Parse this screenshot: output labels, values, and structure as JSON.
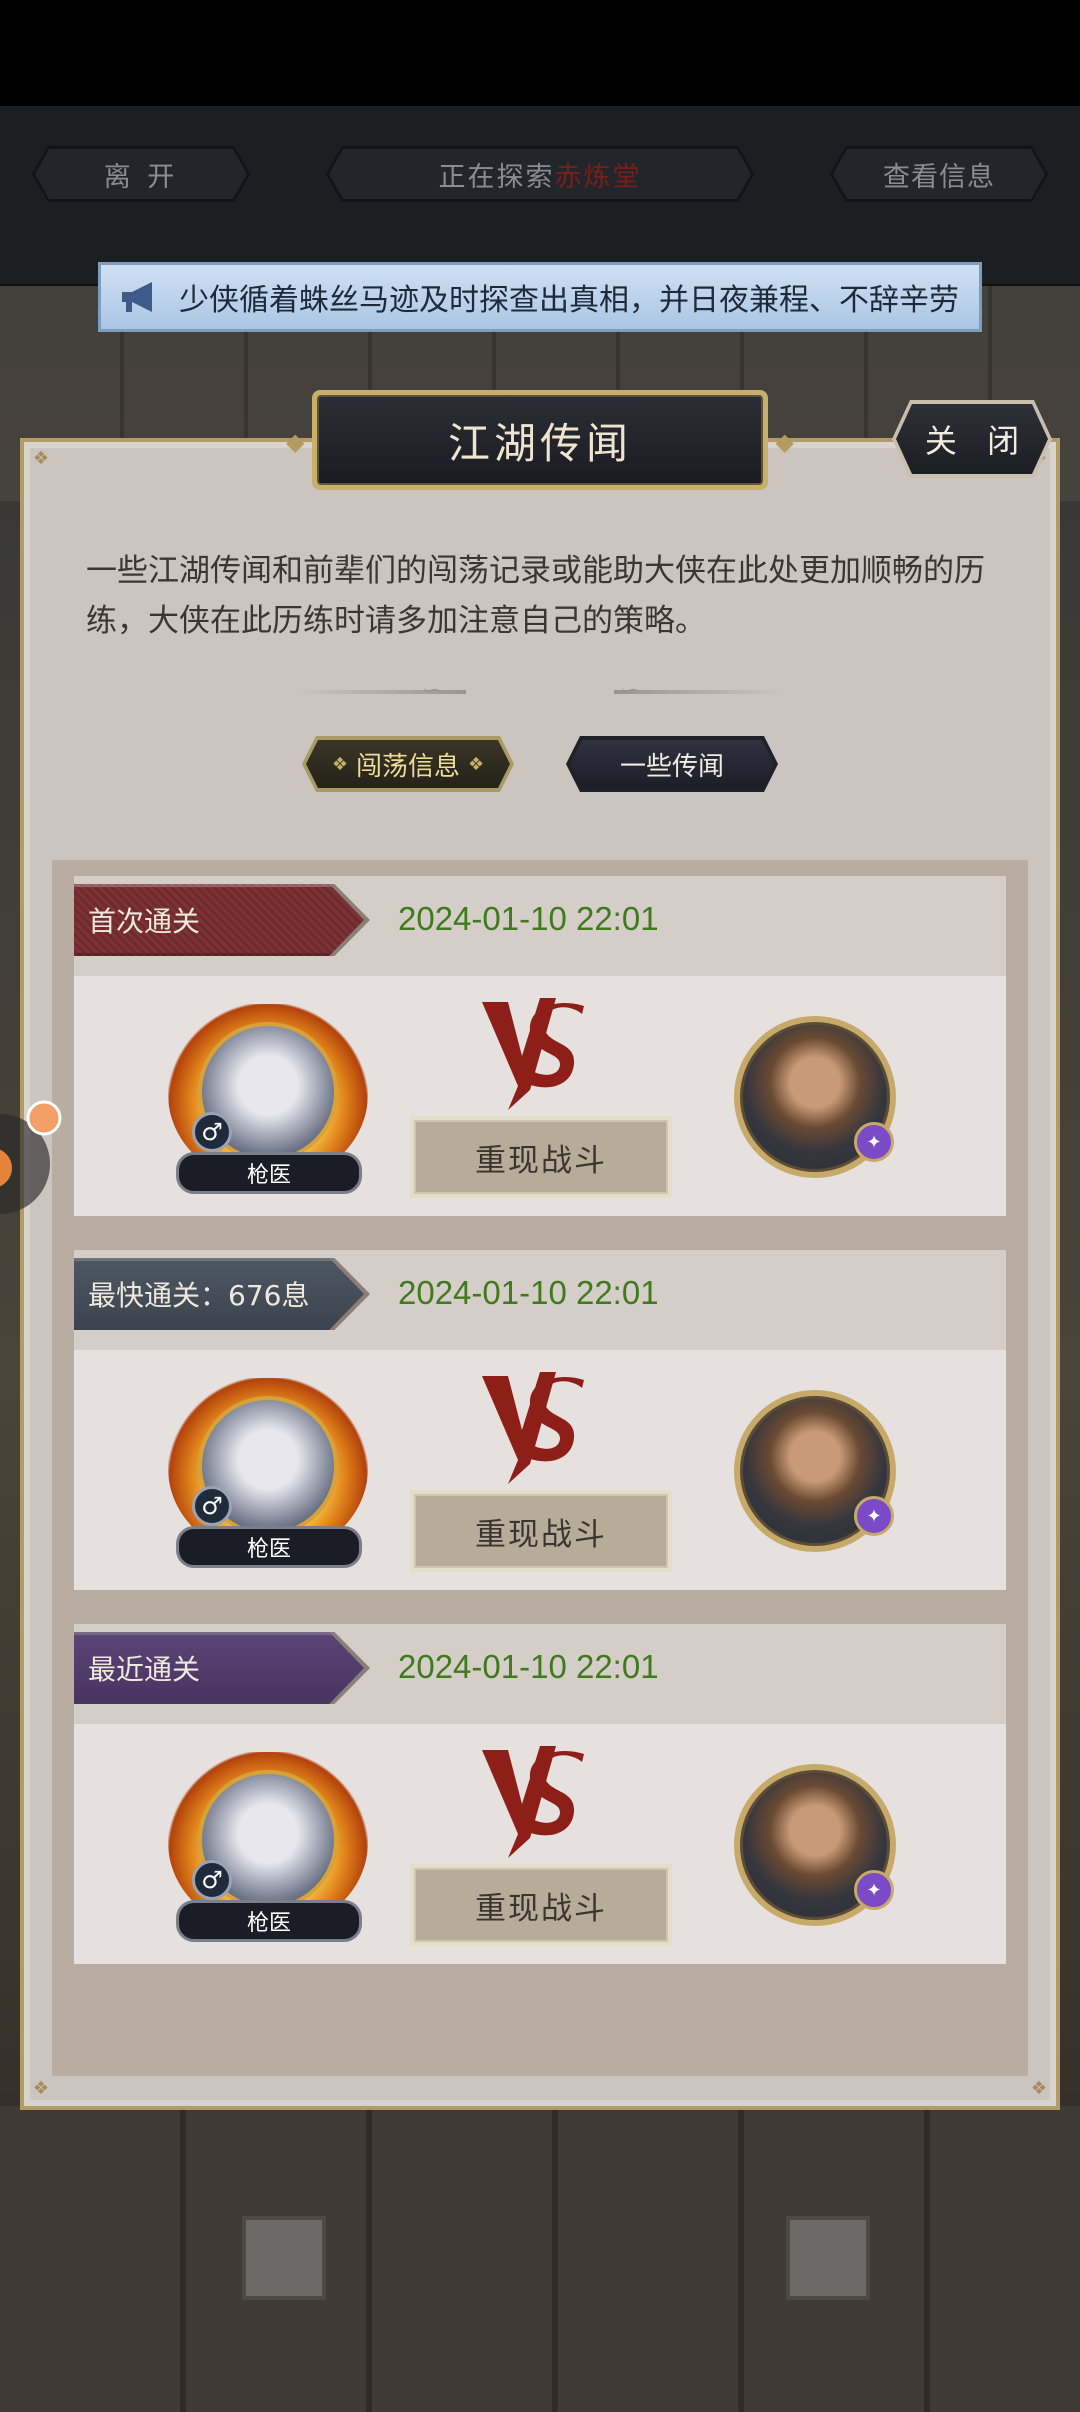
{
  "topbar": {
    "leave_label": "离 开",
    "exploring_prefix": "正在探索",
    "exploring_location": "赤炼堂",
    "view_info_label": "查看信息"
  },
  "banner": {
    "icon": "megaphone-icon",
    "text": "少侠循着蛛丝马迹及时探查出真相，并日夜兼程、不辞辛劳"
  },
  "panel": {
    "title": "江湖传闻",
    "close_label": "关 闭",
    "intro": "一些江湖传闻和前辈们的闯荡记录或能助大侠在此处更加顺畅的历练，大侠在此历练时请多加注意自己的策略。",
    "tabs": [
      {
        "label": "闯荡信息",
        "active": true
      },
      {
        "label": "一些传闻",
        "active": false
      }
    ]
  },
  "records": [
    {
      "label": "首次通关",
      "time": "2024-01-10 22:01",
      "ribbon_color": "#6e2a2d",
      "hero_name": "枪医",
      "hero_gender": "♂",
      "replay_label": "重现战斗"
    },
    {
      "label": "最快通关：676息",
      "time": "2024-01-10 22:01",
      "ribbon_color": "#4d5762",
      "hero_name": "枪医",
      "hero_gender": "♂",
      "replay_label": "重现战斗"
    },
    {
      "label": "最近通关",
      "time": "2024-01-10 22:01",
      "ribbon_color": "#5a4478",
      "hero_name": "枪医",
      "hero_gender": "♂",
      "replay_label": "重现战斗"
    }
  ],
  "colors": {
    "time_green": "#3f7a1c",
    "panel_bg": "#cbc4bf",
    "accent_gold": "#c7b06a",
    "location_red": "#7a1e16"
  }
}
